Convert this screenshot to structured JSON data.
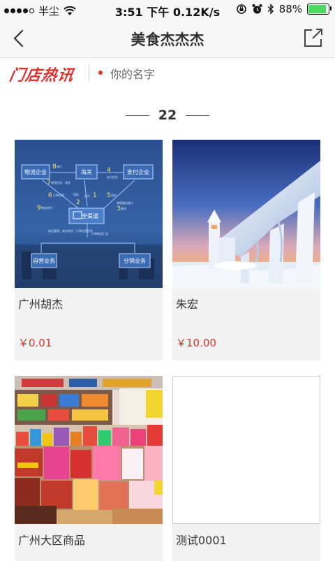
{
  "status_bar": {
    "carrier": "半尘",
    "time": "3:51 下午",
    "speed": "0.12K/s",
    "battery": "88%",
    "battery_level": 0.88
  },
  "nav": {
    "title": "美食杰杰杰"
  },
  "news_strip": {
    "logo_text": "门店热讯",
    "text": "你的名字"
  },
  "section": {
    "heading": "22"
  },
  "diagram": {
    "nodes": {
      "logistics": "物流企业",
      "customs": "海关",
      "payment": "支付企业",
      "center": "全渠道",
      "self": "自营业务",
      "distribution": "分销业务"
    },
    "labels": {
      "n8": "8",
      "n8_text": "放行",
      "n7": "7",
      "n7_text": "物流信息、清关",
      "n4": "4",
      "n4_text": "支付信息",
      "n6": "6",
      "n6_text": "订单信息",
      "n2": "2",
      "n1": "1",
      "n5": "5",
      "n5_text": "回执",
      "n9": "9",
      "n9_text": "物流单号",
      "n3": "3",
      "n3_text": "推送",
      "report": "报文",
      "receipt": "回执",
      "order_push": "订单推送汇总",
      "center_note": "商品管理、库存同步、订单信息回传",
      "cross_border": "跨境服务接口"
    }
  },
  "products": [
    {
      "name": "广州胡杰",
      "price": "￥0.01",
      "image": "diagram"
    },
    {
      "name": "朱宏",
      "price": "￥10.00",
      "image": "ice-pier"
    },
    {
      "name": "广州大区商品",
      "price": "",
      "image": "supermarket"
    },
    {
      "name": "测试0001",
      "price": "",
      "image": "empty"
    }
  ],
  "colors": {
    "accent": "#e0312f",
    "card_bg": "#f2f2f2",
    "battery_green": "#4cd964"
  }
}
